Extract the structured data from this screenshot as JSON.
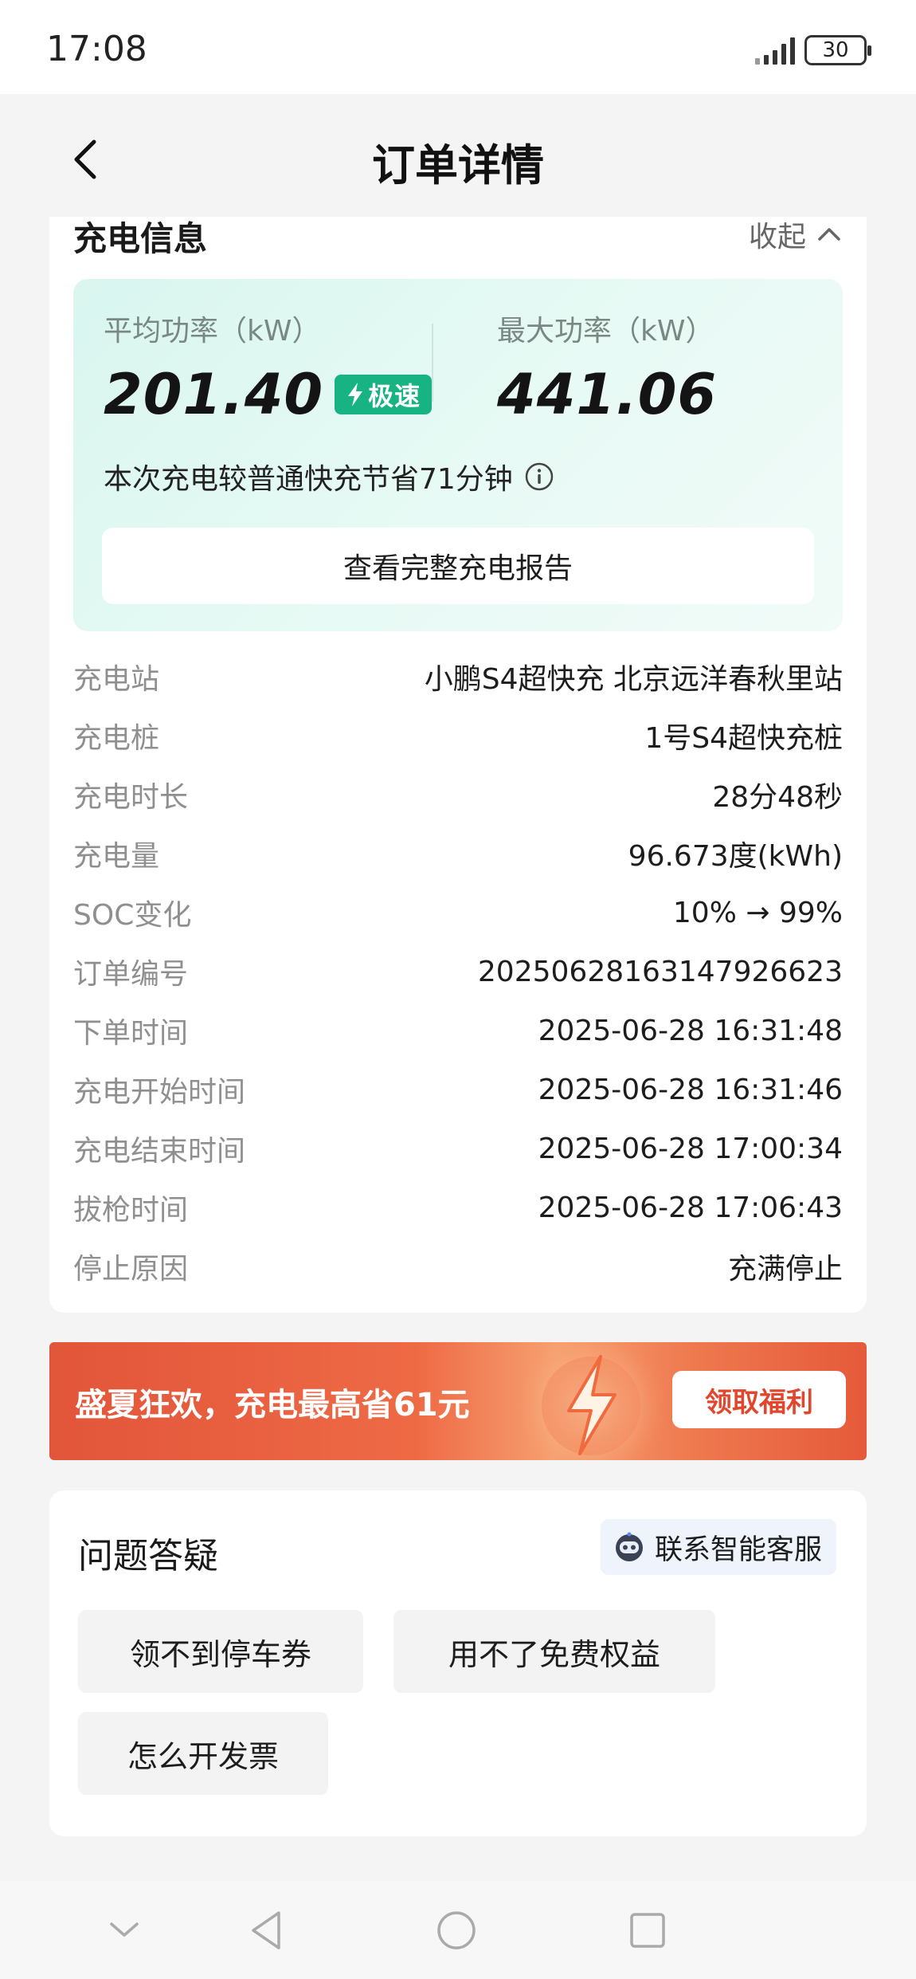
{
  "status_bar": {
    "time": "17:08",
    "battery": "30"
  },
  "header": {
    "title": "订单详情"
  },
  "charging_info": {
    "title": "充电信息",
    "collapse_label": "收起",
    "avg_power_label": "平均功率（kW）",
    "avg_power_value": "201.40",
    "speed_badge": "极速",
    "max_power_label": "最大功率（kW）",
    "max_power_value": "441.06",
    "saving_text": "本次充电较普通快充节省71分钟",
    "report_button": "查看完整充电报告",
    "rows": [
      {
        "label": "充电站",
        "value": "小鹏S4超快充 北京远洋春秋里站"
      },
      {
        "label": "充电桩",
        "value": "1号S4超快充桩"
      },
      {
        "label": "充电时长",
        "value": "28分48秒"
      },
      {
        "label": "充电量",
        "value": "96.673度(kWh)"
      },
      {
        "label": "SOC变化",
        "value": "10% → 99%"
      },
      {
        "label": "订单编号",
        "value": "20250628163147926623"
      },
      {
        "label": "下单时间",
        "value": "2025-06-28 16:31:48"
      },
      {
        "label": "充电开始时间",
        "value": "2025-06-28 16:31:46"
      },
      {
        "label": "充电结束时间",
        "value": "2025-06-28 17:00:34"
      },
      {
        "label": "拔枪时间",
        "value": "2025-06-28 17:06:43"
      },
      {
        "label": "停止原因",
        "value": "充满停止"
      }
    ]
  },
  "promo": {
    "text": "盛夏狂欢，充电最高省61元",
    "button": "领取福利"
  },
  "faq": {
    "title": "问题答疑",
    "service_button": "联系智能客服",
    "chips": [
      "领不到停车券",
      "用不了免费权益",
      "怎么开发票"
    ]
  },
  "colors": {
    "accent_green": "#17b382",
    "promo_red": "#e0472c",
    "page_bg": "#f4f4f4"
  },
  "icons": [
    "back-arrow-icon",
    "chevron-up-icon",
    "lightning-icon",
    "info-icon",
    "robot-icon",
    "nav-hide-icon",
    "nav-back-icon",
    "nav-home-icon",
    "nav-recents-icon"
  ]
}
